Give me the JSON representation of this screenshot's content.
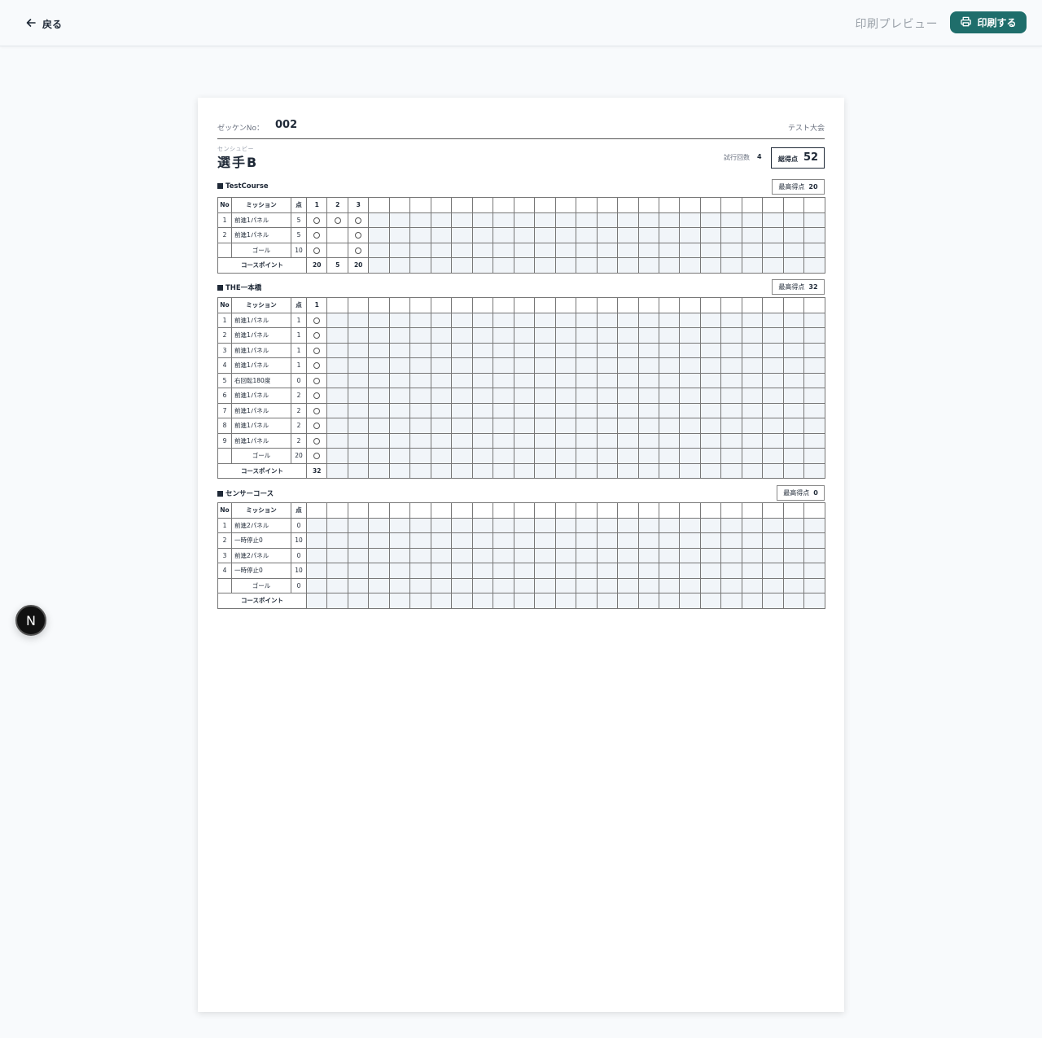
{
  "topbar": {
    "back_label": "戻る",
    "preview_label": "印刷プレビュー",
    "print_label": "印刷する"
  },
  "sheet": {
    "bib_label": "ゼッケンNo：",
    "bib_value": "002",
    "event_name": "テスト大会",
    "player_ruby": "センシュビー",
    "player_name": "選手B",
    "attempts_label": "試行回数",
    "attempts_value": "4",
    "total_label": "総得点",
    "total_value": "52"
  },
  "headers": {
    "no": "No",
    "mission": "ミッション",
    "points": "点",
    "course_point": "コースポイント",
    "best_label": "最高得点"
  },
  "courses": [
    {
      "title": "TestCourse",
      "best": "20",
      "attempts": [
        "1",
        "2",
        "3"
      ],
      "rows": [
        {
          "no": "1",
          "mission": "前進1パネル",
          "points": "5",
          "marks": [
            true,
            true,
            true
          ]
        },
        {
          "no": "2",
          "mission": "前進1パネル",
          "points": "5",
          "marks": [
            true,
            false,
            true
          ]
        },
        {
          "no": "",
          "mission": "ゴール",
          "points": "10",
          "marks": [
            true,
            false,
            true
          ]
        }
      ],
      "totals": [
        "20",
        "5",
        "20"
      ]
    },
    {
      "title": "THE一本橋",
      "best": "32",
      "attempts": [
        "1"
      ],
      "rows": [
        {
          "no": "1",
          "mission": "前進1パネル",
          "points": "1",
          "marks": [
            true
          ]
        },
        {
          "no": "2",
          "mission": "前進1パネル",
          "points": "1",
          "marks": [
            true
          ]
        },
        {
          "no": "3",
          "mission": "前進1パネル",
          "points": "1",
          "marks": [
            true
          ]
        },
        {
          "no": "4",
          "mission": "前進1パネル",
          "points": "1",
          "marks": [
            true
          ]
        },
        {
          "no": "5",
          "mission": "右回転180度",
          "points": "0",
          "marks": [
            true
          ]
        },
        {
          "no": "6",
          "mission": "前進1パネル",
          "points": "2",
          "marks": [
            true
          ]
        },
        {
          "no": "7",
          "mission": "前進1パネル",
          "points": "2",
          "marks": [
            true
          ]
        },
        {
          "no": "8",
          "mission": "前進1パネル",
          "points": "2",
          "marks": [
            true
          ]
        },
        {
          "no": "9",
          "mission": "前進1パネル",
          "points": "2",
          "marks": [
            true
          ]
        },
        {
          "no": "",
          "mission": "ゴール",
          "points": "20",
          "marks": [
            true
          ]
        }
      ],
      "totals": [
        "32"
      ]
    },
    {
      "title": "センサーコース",
      "best": "0",
      "attempts": [],
      "rows": [
        {
          "no": "1",
          "mission": "前進2パネル",
          "points": "0",
          "marks": []
        },
        {
          "no": "2",
          "mission": "一時停止0",
          "points": "10",
          "marks": []
        },
        {
          "no": "3",
          "mission": "前進2パネル",
          "points": "0",
          "marks": []
        },
        {
          "no": "4",
          "mission": "一時停止0",
          "points": "10",
          "marks": []
        },
        {
          "no": "",
          "mission": "ゴール",
          "points": "0",
          "marks": []
        }
      ],
      "totals": []
    }
  ],
  "badge": {
    "label": "N"
  }
}
